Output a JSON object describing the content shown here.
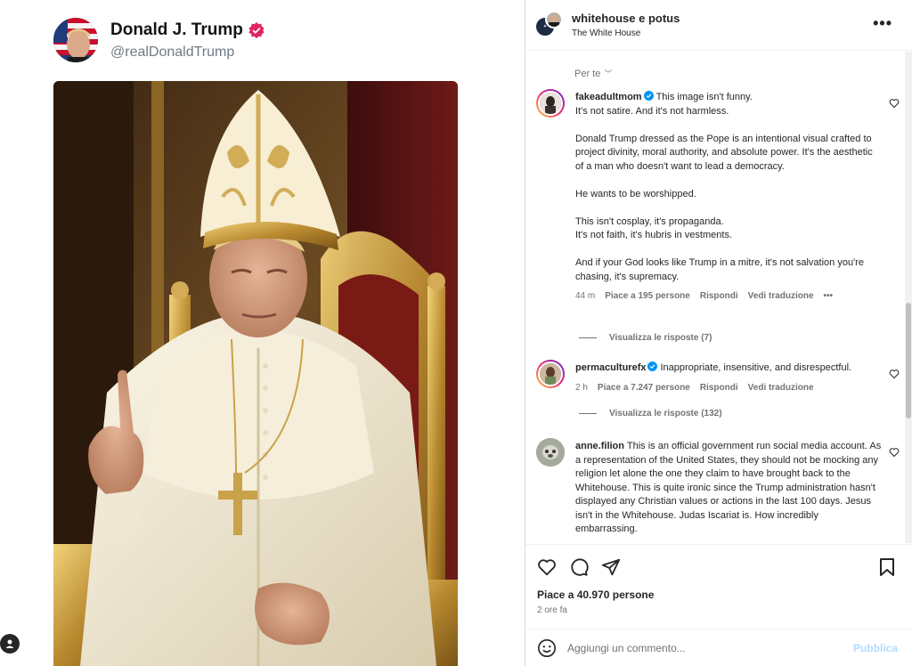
{
  "post": {
    "display_name": "Donald J. Trump",
    "handle": "@realDonaldTrump",
    "verified_color": "#e0245e"
  },
  "header": {
    "title": "whitehouse e potus",
    "subtitle": "The White House",
    "more": "•••"
  },
  "sort": {
    "label": "Per te",
    "chevron": "﹀"
  },
  "comments": [
    {
      "user": "fakeadultmom",
      "text_lines": [
        "This image isn't funny.",
        "It's not satire. And it's not harmless.",
        "",
        "Donald Trump dressed as the Pope is an intentional visual crafted to project divinity, moral authority, and absolute power. It's the aesthetic of a man who doesn't want to lead a democracy.",
        "",
        "He wants to be worshipped.",
        "",
        "This isn't cosplay, it's propaganda.",
        "It's not faith, it's hubris in vestments.",
        "",
        "And if your God looks like Trump in a mitre, it's not salvation you're chasing, it's supremacy."
      ],
      "time": "44 m",
      "likes": "Piace a 195 persone",
      "reply": "Rispondi",
      "translate": "Vedi traduzione",
      "more": "•••",
      "view_replies": "Visualizza le risposte (7)"
    },
    {
      "user": "permaculturefx",
      "text": "Inappropriate, insensitive, and disrespectful.",
      "time": "2 h",
      "likes": "Piace a 7.247 persone",
      "reply": "Rispondi",
      "translate": "Vedi traduzione",
      "view_replies": "Visualizza le risposte (132)"
    },
    {
      "user": "anne.filion",
      "text": "This is an official government run social media account. As a representation of the United States, they should not be mocking any religion let alone the one they claim to have brought back to the Whitehouse. This is quite ironic since the Trump administration hasn't displayed any Christian values or actions in the last 100 days. Jesus isn't in the Whitehouse. Judas Iscariat is. How incredibly embarrassing."
    }
  ],
  "actions": {
    "likes": "Piace a 40.970 persone",
    "time": "2 ore fa"
  },
  "composer": {
    "placeholder": "Aggiungi un commento...",
    "publish": "Pubblica"
  },
  "icons": {
    "like": "heart-icon",
    "comment": "comment-icon",
    "share": "share-icon",
    "save": "bookmark-icon",
    "emoji": "emoji-icon"
  },
  "colors": {
    "verified": "#0095f6",
    "publish_disabled": "#b3dbff",
    "text": "#262626",
    "muted": "#737373"
  }
}
